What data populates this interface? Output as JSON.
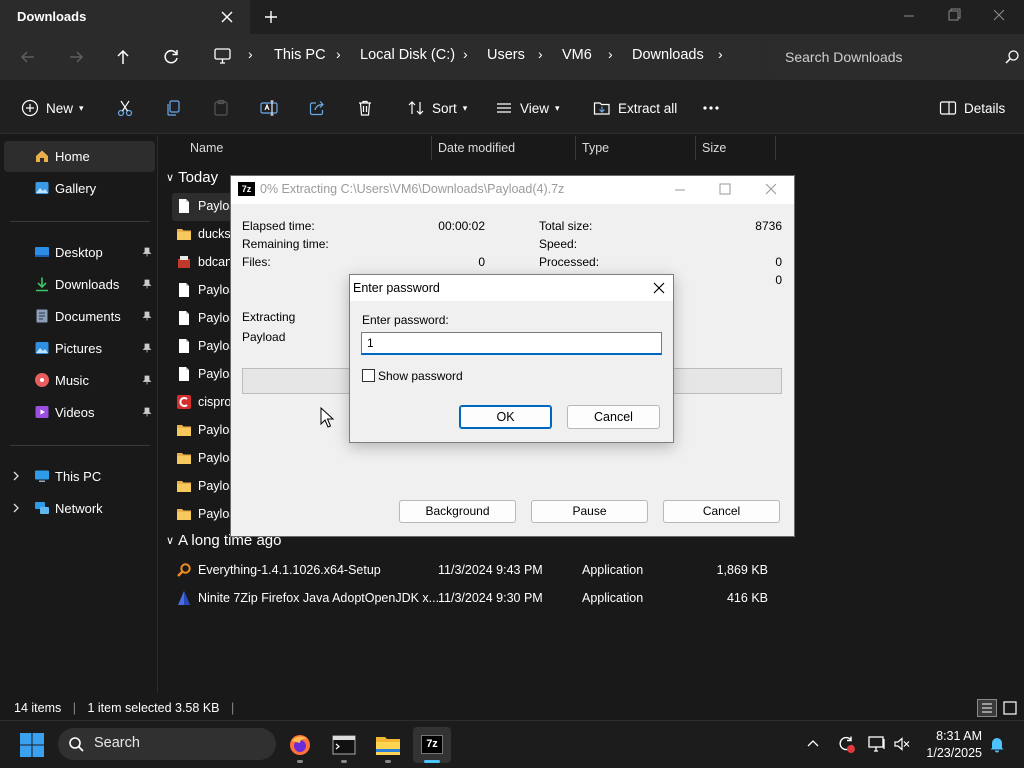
{
  "window": {
    "tab_title": "Downloads",
    "search_placeholder": "Search Downloads",
    "breadcrumb": [
      "This PC",
      "Local Disk (C:)",
      "Users",
      "VM6",
      "Downloads"
    ]
  },
  "toolbar": {
    "new_label": "New",
    "sort_label": "Sort",
    "view_label": "View",
    "extract_label": "Extract all",
    "details_label": "Details"
  },
  "sidebar": {
    "items": [
      {
        "label": "Home",
        "icon": "home-icon"
      },
      {
        "label": "Gallery",
        "icon": "gallery-icon"
      },
      {
        "label": "Desktop",
        "icon": "desktop-icon"
      },
      {
        "label": "Downloads",
        "icon": "download-icon"
      },
      {
        "label": "Documents",
        "icon": "documents-icon"
      },
      {
        "label": "Pictures",
        "icon": "pictures-icon"
      },
      {
        "label": "Music",
        "icon": "music-icon"
      },
      {
        "label": "Videos",
        "icon": "videos-icon"
      },
      {
        "label": "This PC",
        "icon": "computer-icon"
      },
      {
        "label": "Network",
        "icon": "network-icon"
      }
    ]
  },
  "filelist": {
    "columns": [
      "Name",
      "Date modified",
      "Type",
      "Size"
    ],
    "group_today": "Today",
    "group_old": "A long time ago",
    "today_rows": [
      "Payloa",
      "ducks",
      "bdcan",
      "Payloa",
      "Payloa",
      "Payloa",
      "Payloa",
      "cispro",
      "Payloa",
      "Payloa",
      "Payloa",
      "Payloa"
    ],
    "old_rows": [
      {
        "name": "Everything-1.4.1.1026.x64-Setup",
        "date": "11/3/2024 9:43 PM",
        "type": "Application",
        "size": "1,869 KB"
      },
      {
        "name": "Ninite 7Zip Firefox Java AdoptOpenJDK x...",
        "date": "11/3/2024 9:30 PM",
        "type": "Application",
        "size": "416 KB"
      }
    ]
  },
  "status": {
    "items": "14 items",
    "selected": "1 item selected  3.58 KB"
  },
  "sevenzip": {
    "logo": "7z",
    "title": "0% Extracting C:\\Users\\VM6\\Downloads\\Payload(4).7z",
    "elapsed_label": "Elapsed time:",
    "elapsed_value": "00:00:02",
    "remaining_label": "Remaining time:",
    "files_label": "Files:",
    "files_value": "0",
    "total_label": "Total size:",
    "total_value": "8736",
    "speed_label": "Speed:",
    "processed_label": "Processed:",
    "processed_value": "0",
    "packed_value": "0",
    "extracting_label": "Extracting",
    "current_file": "Payload",
    "progress": 0,
    "btn_background": "Background",
    "btn_pause": "Pause",
    "btn_cancel": "Cancel"
  },
  "password_dialog": {
    "title": "Enter password",
    "label": "Enter password:",
    "value": "1",
    "show_password_label": "Show password",
    "ok_label": "OK",
    "cancel_label": "Cancel"
  },
  "taskbar": {
    "search_label": "Search",
    "time": "8:31 AM",
    "date": "1/23/2025",
    "sevenzip_logo": "7z"
  },
  "colors": {
    "accent": "#0067c0",
    "window_bg": "#191919",
    "dialog_bg": "#f0f0f0"
  }
}
